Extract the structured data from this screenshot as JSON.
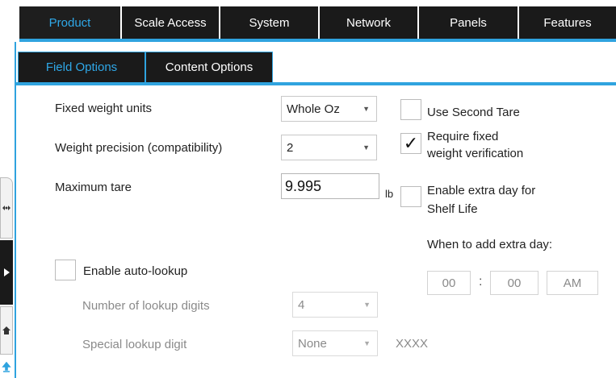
{
  "top_tabs": [
    "Product",
    "Scale Access",
    "System",
    "Network",
    "Panels",
    "Features"
  ],
  "sub_tabs": [
    "Field Options",
    "Content Options"
  ],
  "fixed_weight": {
    "label": "Fixed weight units",
    "value": "Whole Oz"
  },
  "weight_precision": {
    "label": "Weight precision (compatibility)",
    "value": "2"
  },
  "max_tare": {
    "label": "Maximum tare",
    "value": "9.995",
    "unit": "lb"
  },
  "use_second_tare": {
    "label": "Use Second Tare",
    "checked": false
  },
  "require_fixed": {
    "line1": "Require fixed",
    "line2": "weight verification",
    "checked": true,
    "mark": "✓"
  },
  "extra_day": {
    "line1": "Enable extra day for",
    "line2": "Shelf Life",
    "checked": false
  },
  "when_extra_day": {
    "label": "When to add extra day:",
    "hour": "00",
    "sep": ":",
    "minute": "00",
    "ampm": "AM"
  },
  "auto_lookup": {
    "label": "Enable auto-lookup",
    "checked": false
  },
  "lookup_digits": {
    "label": "Number of lookup digits",
    "value": "4"
  },
  "special_digit": {
    "label": "Special lookup digit",
    "value": "None",
    "pattern": "XXXX"
  },
  "icons": [
    "scale-icon",
    "play-icon",
    "home-icon",
    "upload-icon"
  ],
  "colors": {
    "accent": "#2fa3df",
    "tab_bg": "#1a1a1a",
    "active_tab_text": "#2fa8e8"
  }
}
